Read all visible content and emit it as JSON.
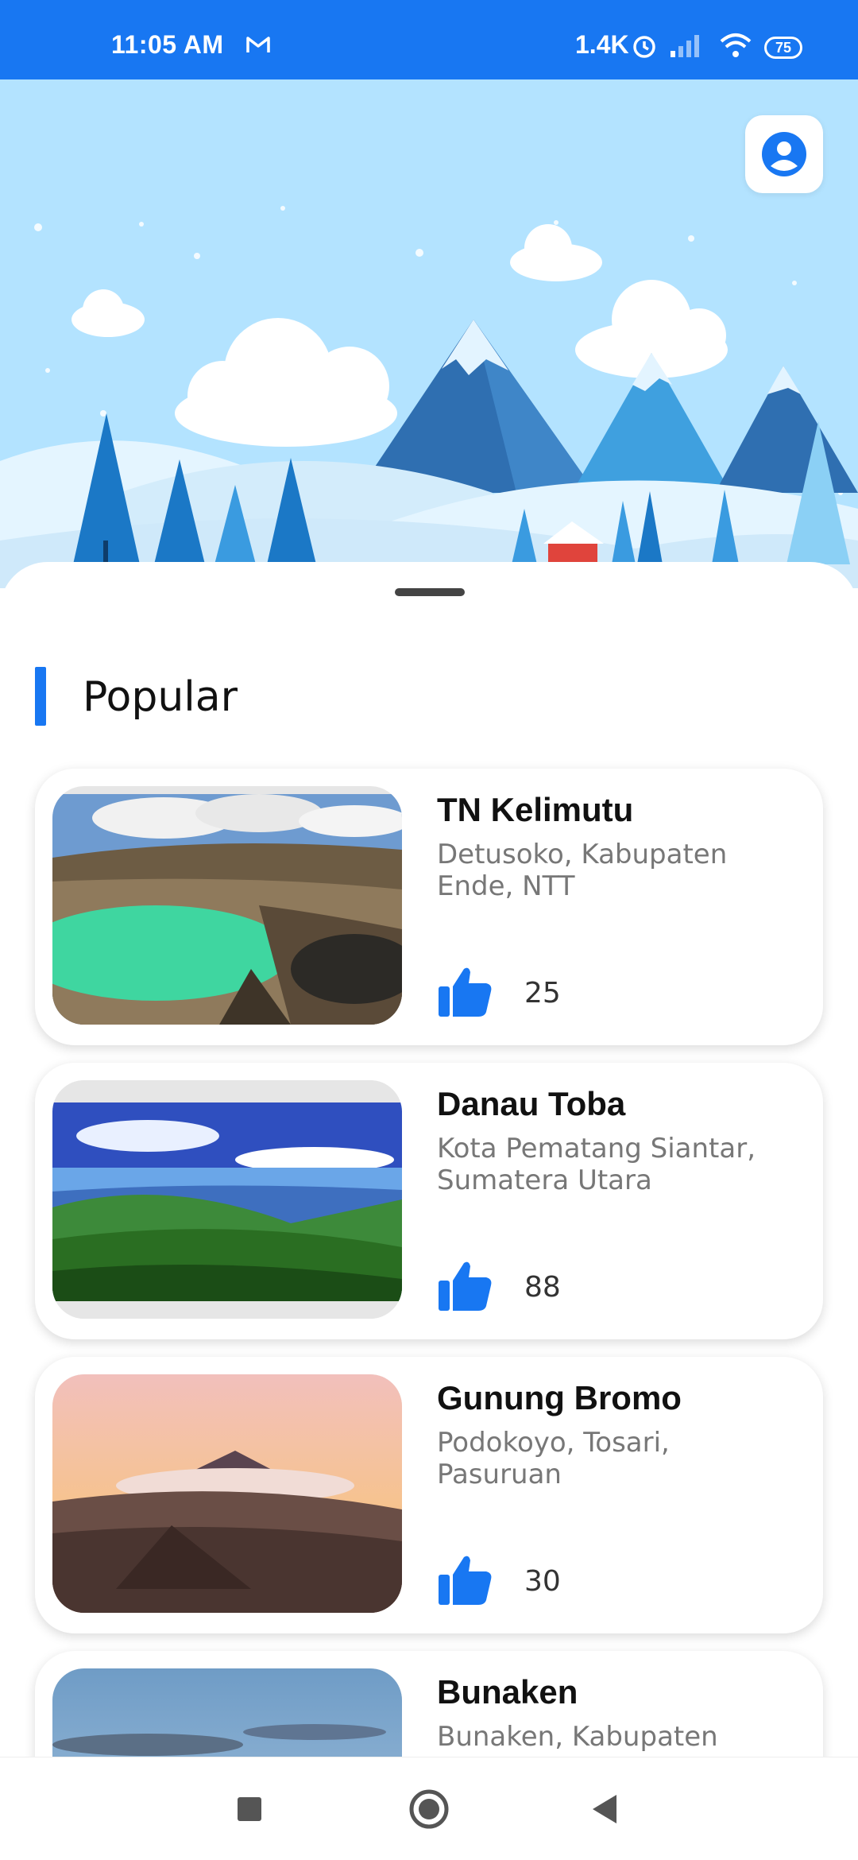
{
  "status_bar": {
    "time": "11:05 AM",
    "network_speed": "1.4K",
    "battery": "75",
    "icons": [
      "gmail-icon",
      "alarm-icon",
      "signal-icon",
      "wifi-icon",
      "battery-icon"
    ]
  },
  "hero": {
    "profile_icon": "account-circle-icon"
  },
  "section": {
    "title": "Popular"
  },
  "places": [
    {
      "name": "TN Kelimutu",
      "location": "Detusoko, Kabupaten Ende, NTT",
      "likes": "25"
    },
    {
      "name": "Danau Toba",
      "location": "Kota Pematang Siantar, Sumatera Utara",
      "likes": "88"
    },
    {
      "name": "Gunung Bromo",
      "location": "Podokoyo, Tosari, Pasuruan",
      "likes": "30"
    },
    {
      "name": "Bunaken",
      "location": "Bunaken, Kabupaten Manado, Sulawesi Utara",
      "likes": ""
    }
  ],
  "colors": {
    "primary": "#1877f2",
    "hero_sky": "#b3e3ff",
    "text_dark": "#111111",
    "text_muted": "#777777"
  },
  "nav": {
    "icons": [
      "recent-apps-icon",
      "home-icon",
      "back-icon"
    ]
  }
}
